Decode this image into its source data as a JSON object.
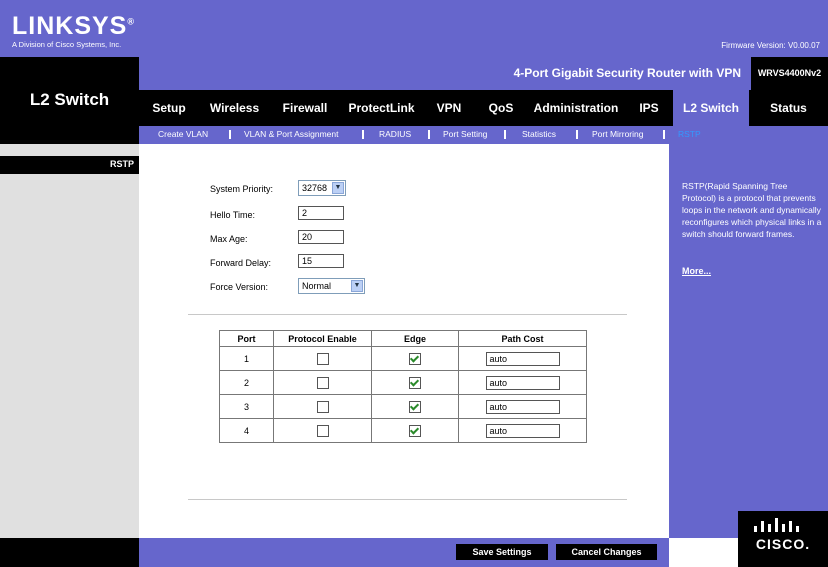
{
  "header": {
    "logo": "LINKSYS",
    "logo_registered": "®",
    "logo_subtitle": "A Division of Cisco Systems, Inc.",
    "firmware": "Firmware Version: V0.00.07",
    "product_name": "4-Port Gigabit Security Router with VPN",
    "model": "WRVS4400Nv2",
    "section_title": "L2 Switch"
  },
  "tabs": [
    {
      "label": "Setup"
    },
    {
      "label": "Wireless"
    },
    {
      "label": "Firewall"
    },
    {
      "label": "ProtectLink"
    },
    {
      "label": "VPN"
    },
    {
      "label": "QoS"
    },
    {
      "label": "Administration"
    },
    {
      "label": "IPS"
    },
    {
      "label": "L2 Switch"
    },
    {
      "label": "Status"
    }
  ],
  "subtabs": [
    {
      "label": "Create VLAN"
    },
    {
      "label": "VLAN & Port Assignment"
    },
    {
      "label": "RADIUS"
    },
    {
      "label": "Port Setting"
    },
    {
      "label": "Statistics"
    },
    {
      "label": "Port Mirroring"
    },
    {
      "label": "RSTP"
    }
  ],
  "left_section": "RSTP",
  "form": {
    "system_priority_label": "System Priority:",
    "system_priority_value": "32768",
    "hello_time_label": "Hello Time:",
    "hello_time_value": "2",
    "max_age_label": "Max Age:",
    "max_age_value": "20",
    "forward_delay_label": "Forward Delay:",
    "forward_delay_value": "15",
    "force_version_label": "Force Version:",
    "force_version_value": "Normal"
  },
  "table": {
    "headers": [
      "Port",
      "Protocol Enable",
      "Edge",
      "Path Cost"
    ],
    "rows": [
      {
        "port": "1",
        "protocol_enable": false,
        "edge": true,
        "path_cost": "auto"
      },
      {
        "port": "2",
        "protocol_enable": false,
        "edge": true,
        "path_cost": "auto"
      },
      {
        "port": "3",
        "protocol_enable": false,
        "edge": true,
        "path_cost": "auto"
      },
      {
        "port": "4",
        "protocol_enable": false,
        "edge": true,
        "path_cost": "auto"
      }
    ]
  },
  "help": {
    "text": "RSTP(Rapid Spanning Tree Protocol) is a protocol that prevents loops in the network and dynamically reconfigures which physical links in a switch should forward frames.",
    "more": "More..."
  },
  "buttons": {
    "save": "Save Settings",
    "cancel": "Cancel Changes"
  },
  "footer_logo": "CISCO.",
  "colors": {
    "brand_purple": "#6666cc",
    "active_subtab": "#3399ff",
    "checkbox_check": "#2a8a2a"
  }
}
